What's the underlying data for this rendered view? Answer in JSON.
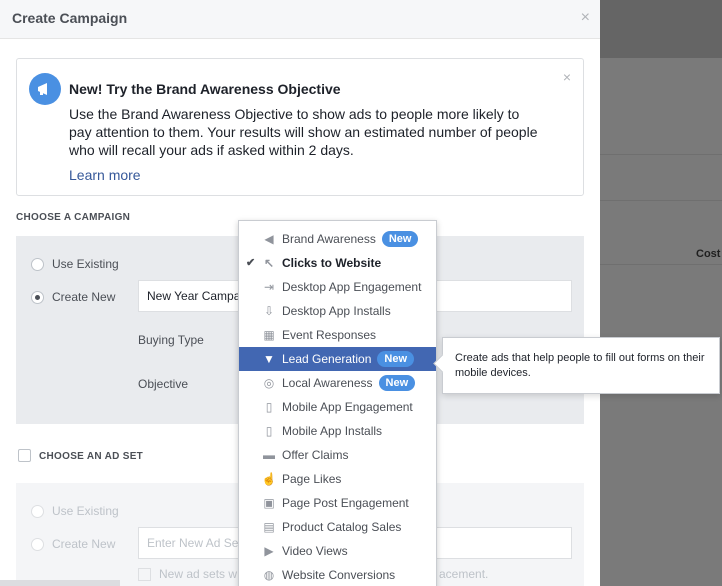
{
  "modal": {
    "title": "Create Campaign",
    "close": "×"
  },
  "notice": {
    "title": "New! Try the Brand Awareness Objective",
    "body": "Use the Brand Awareness Objective to show ads to people more likely to pay attention to them. Your results will show an estimated number of people who will recall your ads if asked within 2 days.",
    "link": "Learn more",
    "close": "×"
  },
  "campaign": {
    "section_label": "CHOOSE A CAMPAIGN",
    "use_existing": "Use Existing",
    "create_new": "Create New",
    "name_value": "New Year Campa",
    "buying_type_label": "Buying Type",
    "objective_label": "Objective"
  },
  "adset": {
    "section_label": "CHOOSE AN AD SET",
    "use_existing": "Use Existing",
    "create_new": "Create New",
    "name_placeholder": "Enter New Ad Se",
    "note": "New ad sets w",
    "note_tail": "acement."
  },
  "background": {
    "cost_label": "Cost"
  },
  "objectives": [
    {
      "label": "Brand Awareness",
      "icon": "megaphone-icon",
      "badge": "New"
    },
    {
      "label": "Clicks to Website",
      "icon": "cursor-icon",
      "checked": true
    },
    {
      "label": "Desktop App Engagement",
      "icon": "desktop-app-engagement-icon"
    },
    {
      "label": "Desktop App Installs",
      "icon": "desktop-app-install-icon"
    },
    {
      "label": "Event Responses",
      "icon": "calendar-icon"
    },
    {
      "label": "Lead Generation",
      "icon": "funnel-icon",
      "badge": "New",
      "active": true
    },
    {
      "label": "Local Awareness",
      "icon": "location-pin-icon",
      "badge": "New"
    },
    {
      "label": "Mobile App Engagement",
      "icon": "mobile-app-engagement-icon"
    },
    {
      "label": "Mobile App Installs",
      "icon": "mobile-app-install-icon"
    },
    {
      "label": "Offer Claims",
      "icon": "offer-icon"
    },
    {
      "label": "Page Likes",
      "icon": "thumbs-up-icon"
    },
    {
      "label": "Page Post Engagement",
      "icon": "chat-bubbles-icon"
    },
    {
      "label": "Product Catalog Sales",
      "icon": "cart-icon"
    },
    {
      "label": "Video Views",
      "icon": "video-camera-icon"
    },
    {
      "label": "Website Conversions",
      "icon": "globe-icon"
    }
  ],
  "tooltip": {
    "text": "Create ads that help people to fill out forms on their mobile devices."
  },
  "colors": {
    "accent": "#4267b2",
    "badge": "#4a90e2",
    "link": "#365899"
  }
}
